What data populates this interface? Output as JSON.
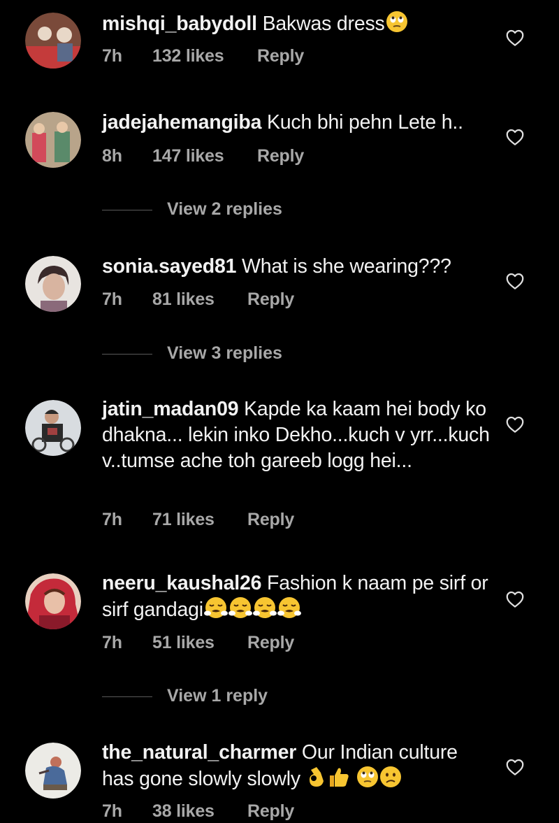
{
  "comments": [
    {
      "username": "mishqi_babydoll",
      "text": "Bakwas dress",
      "emojis": [
        "rolling-eyes"
      ],
      "time": "7h",
      "likes": "132 likes",
      "reply_label": "Reply",
      "avatar_colors": [
        "#7a4a3a",
        "#c43b3b",
        "#e8d8c8"
      ]
    },
    {
      "username": "jadejahemangiba",
      "text": "Kuch bhi pehn Lete h..",
      "emojis": [],
      "time": "8h",
      "likes": "147 likes",
      "reply_label": "Reply",
      "view_replies": "View 2 replies",
      "avatar_colors": [
        "#b8a48a",
        "#d24a5a",
        "#5a8a6a"
      ]
    },
    {
      "username": "sonia.sayed81",
      "text": "What is she wearing???",
      "emojis": [],
      "time": "7h",
      "likes": "81 likes",
      "reply_label": "Reply",
      "view_replies": "View 3 replies",
      "avatar_colors": [
        "#e8e4e0",
        "#3a2a2a",
        "#d8b4a0"
      ]
    },
    {
      "username": "jatin_madan09",
      "text": "Kapde ka kaam hei body ko dhakna... lekin inko Dekho...kuch v yrr...kuch v..tumse ache toh gareeb logg hei...",
      "emojis": [],
      "time": "7h",
      "likes": "71 likes",
      "reply_label": "Reply",
      "avatar_colors": [
        "#d8dce0",
        "#2a2a2a",
        "#a04040"
      ]
    },
    {
      "username": "neeru_kaushal26",
      "text": "Fashion k naam pe sirf or sirf gandagi",
      "emojis": [
        "steam-face",
        "steam-face",
        "steam-face",
        "steam-face"
      ],
      "time": "7h",
      "likes": "51 likes",
      "reply_label": "Reply",
      "view_replies": "View 1 reply",
      "avatar_colors": [
        "#c42a3a",
        "#e8c0a8",
        "#8a1a2a"
      ]
    },
    {
      "username": "the_natural_charmer",
      "text": "Our Indian culture has gone slowly slowly",
      "emojis": [
        "ok-hand",
        "thumbs-up",
        "rolling-eyes",
        "confused-face"
      ],
      "time": "7h",
      "likes": "38 likes",
      "reply_label": "Reply",
      "avatar_colors": [
        "#ecebe6",
        "#c0705a",
        "#4a6a9a"
      ]
    }
  ],
  "icons": {
    "like": "heart-outline-icon"
  },
  "colors": {
    "background": "#000000",
    "primary_text": "#f2f2f2",
    "secondary_text": "#a8a8a8",
    "emoji_yellow": "#f7c531"
  }
}
